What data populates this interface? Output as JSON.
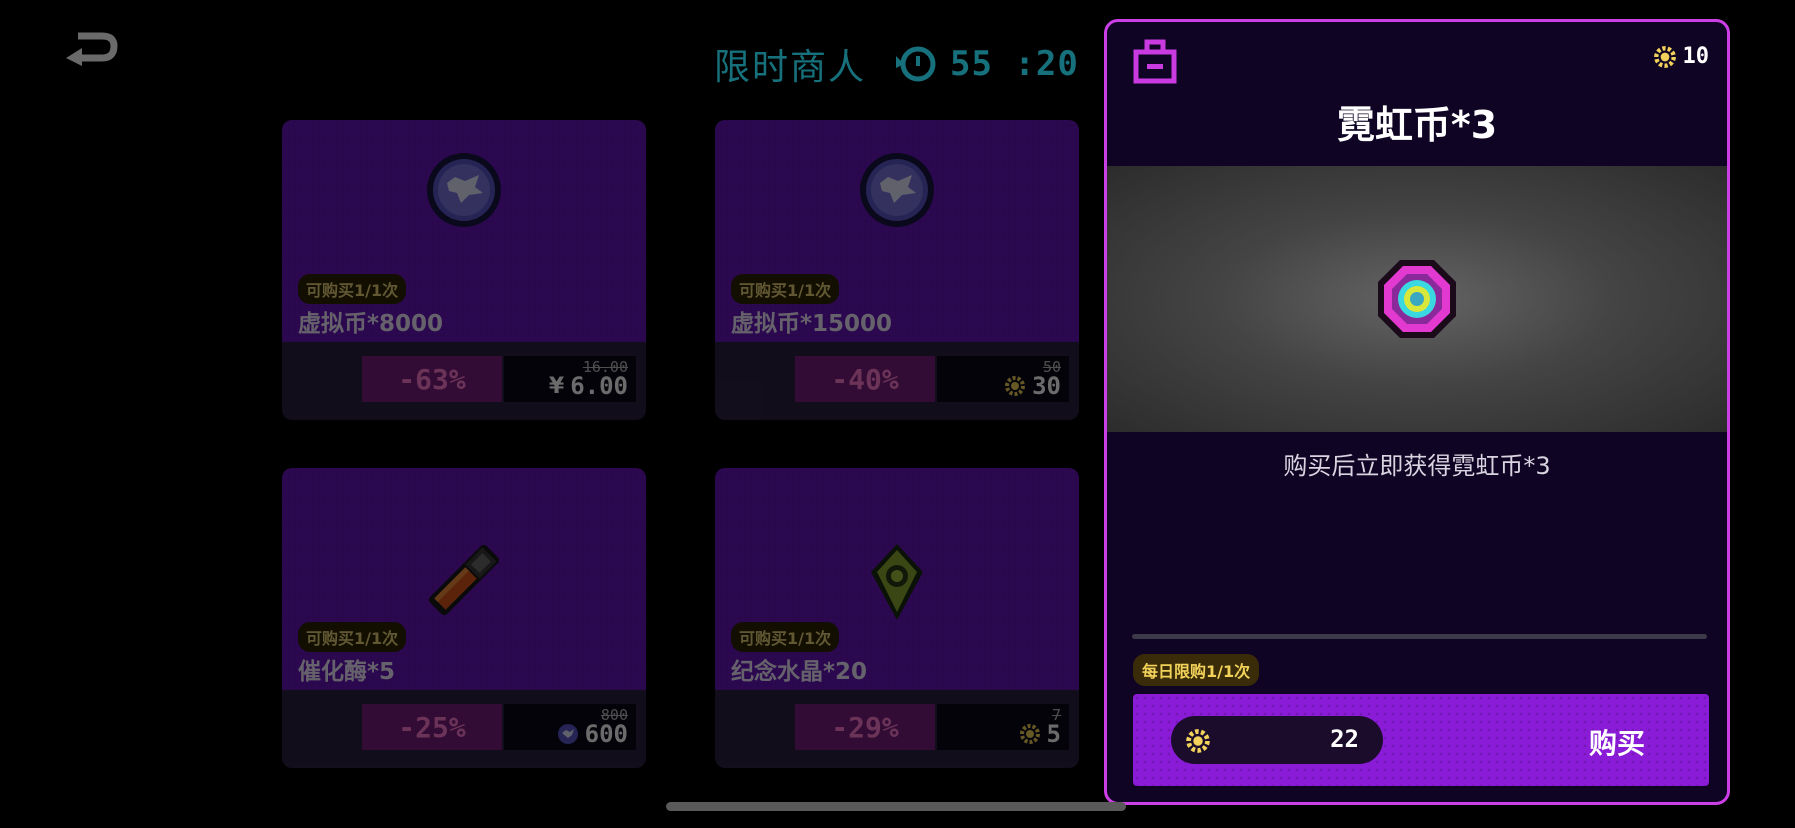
{
  "header": {
    "title": "限时商人",
    "timer": "55 :20",
    "icons": {
      "back": "back-arrow-icon",
      "clock": "clock-icon"
    }
  },
  "shop_items": [
    {
      "limit": "可购买1/1次",
      "name": "虚拟币*8000",
      "discount": "-63%",
      "old_price": "16.00",
      "currency_symbol": "¥",
      "new_price": "6.00",
      "icon": "virtual-coin-icon"
    },
    {
      "limit": "可购买1/1次",
      "name": "虚拟币*15000",
      "discount": "-40%",
      "old_price": "50",
      "new_price": "30",
      "price_icon": "neon-gear-coin-icon",
      "icon": "virtual-coin-icon"
    },
    {
      "limit": "可购买1/1次",
      "name": "催化酶*5",
      "discount": "-25%",
      "old_price": "800",
      "new_price": "600",
      "price_icon": "virtual-coin-small-icon",
      "icon": "catalyst-capsule-icon"
    },
    {
      "limit": "可购买1/1次",
      "name": "纪念水晶*20",
      "discount": "-29%",
      "old_price": "7",
      "new_price": "5",
      "price_icon": "neon-gear-coin-icon",
      "icon": "memorial-crystal-icon"
    }
  ],
  "detail_panel": {
    "wallet_amount": "10",
    "title": "霓虹币*3",
    "description": "购买后立即获得霓虹币*3",
    "daily_limit": "每日限购1/1次",
    "price": "22",
    "buy_label": "购买",
    "icons": {
      "bag": "shopping-bag-icon",
      "wallet": "neon-gear-coin-icon",
      "preview": "neon-coin-icon"
    }
  },
  "colors": {
    "accent_magenta": "#cd3fe6",
    "card_purple": "#6a14c0",
    "buy_purple": "#8a1cd8",
    "timer_cyan": "#25b7c8",
    "gold": "#f2d25a"
  }
}
